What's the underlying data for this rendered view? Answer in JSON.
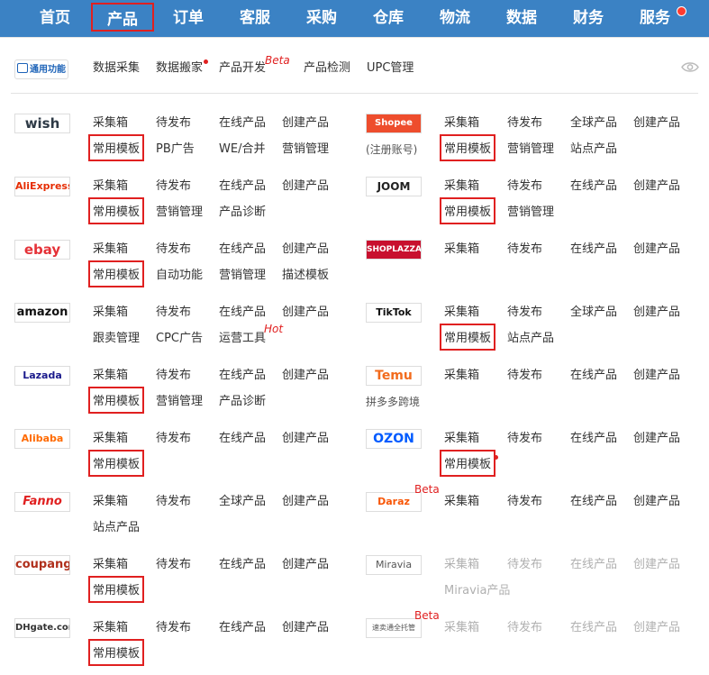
{
  "nav": {
    "items": [
      "首页",
      "产品",
      "订单",
      "客服",
      "采购",
      "仓库",
      "物流",
      "数据",
      "财务",
      "服务"
    ],
    "active": "产品"
  },
  "subnav": {
    "logo_label": "通用功能",
    "items": [
      "数据采集",
      "数据搬家",
      "产品开发",
      "产品检测",
      "UPC管理"
    ],
    "beta_label": "Beta"
  },
  "left_platforms": [
    {
      "logo": "wish",
      "row1": [
        "采集箱",
        "待发布",
        "在线产品",
        "创建产品"
      ],
      "row2": [
        "常用模板",
        "PB广告",
        "WE/合并",
        "营销管理"
      ]
    },
    {
      "logo": "AliExpress",
      "row1": [
        "采集箱",
        "待发布",
        "在线产品",
        "创建产品"
      ],
      "row2": [
        "常用模板",
        "营销管理",
        "产品诊断"
      ]
    },
    {
      "logo": "ebay",
      "row1": [
        "采集箱",
        "待发布",
        "在线产品",
        "创建产品"
      ],
      "row2": [
        "常用模板",
        "自动功能",
        "营销管理",
        "描述模板"
      ]
    },
    {
      "logo": "amazon",
      "row1": [
        "采集箱",
        "待发布",
        "在线产品",
        "创建产品"
      ],
      "row2": [
        "跟卖管理",
        "CPC广告",
        "运营工具"
      ],
      "hot": "Hot"
    },
    {
      "logo": "Lazada",
      "row1": [
        "采集箱",
        "待发布",
        "在线产品",
        "创建产品"
      ],
      "row2": [
        "常用模板",
        "营销管理",
        "产品诊断"
      ]
    },
    {
      "logo": "Alibaba",
      "row1": [
        "采集箱",
        "待发布",
        "在线产品",
        "创建产品"
      ],
      "row2": [
        "常用模板"
      ]
    },
    {
      "logo": "Fanno",
      "row1": [
        "采集箱",
        "待发布",
        "全球产品",
        "创建产品"
      ],
      "row2": [
        "站点产品"
      ]
    },
    {
      "logo": "coupang",
      "row1": [
        "采集箱",
        "待发布",
        "在线产品",
        "创建产品"
      ],
      "row2": [
        "常用模板"
      ]
    },
    {
      "logo": "DHgate.com",
      "row1": [
        "采集箱",
        "待发布",
        "在线产品",
        "创建产品"
      ],
      "row2": [
        "常用模板"
      ]
    }
  ],
  "right_platforms": [
    {
      "logo": "Shopee",
      "note": "(注册账号)",
      "row1": [
        "采集箱",
        "待发布",
        "全球产品",
        "创建产品"
      ],
      "row2": [
        "常用模板",
        "营销管理",
        "站点产品"
      ]
    },
    {
      "logo": "JOOM",
      "row1": [
        "采集箱",
        "待发布",
        "在线产品",
        "创建产品"
      ],
      "row2": [
        "常用模板",
        "营销管理"
      ]
    },
    {
      "logo": "SHOPLAZZA",
      "row1": [
        "采集箱",
        "待发布",
        "在线产品",
        "创建产品"
      ],
      "row2": []
    },
    {
      "logo": "TikTok",
      "row1": [
        "采集箱",
        "待发布",
        "全球产品",
        "创建产品"
      ],
      "row2": [
        "常用模板",
        "站点产品"
      ]
    },
    {
      "logo": "Temu",
      "note": "拼多多跨境",
      "row1": [
        "采集箱",
        "待发布",
        "在线产品",
        "创建产品"
      ],
      "row2": []
    },
    {
      "logo": "OZON",
      "row1": [
        "采集箱",
        "待发布",
        "在线产品",
        "创建产品"
      ],
      "row2": [
        "常用模板"
      ]
    },
    {
      "logo": "Daraz",
      "beta": "Beta",
      "row1": [
        "采集箱",
        "待发布",
        "在线产品",
        "创建产品"
      ],
      "row2": []
    },
    {
      "logo": "Miravia",
      "row1": [
        "采集箱",
        "待发布",
        "在线产品",
        "创建产品"
      ],
      "row2": [
        "Miravia产品"
      ],
      "disabled": true
    },
    {
      "logo": "速卖通全托管",
      "beta": "Beta",
      "row1": [
        "采集箱",
        "待发布",
        "在线产品",
        "创建产品"
      ],
      "row2": [],
      "disabled": true
    }
  ],
  "colors": {
    "nav_bg": "#3b82c4",
    "highlight": "#e02020",
    "accent_red": "#e02020"
  }
}
